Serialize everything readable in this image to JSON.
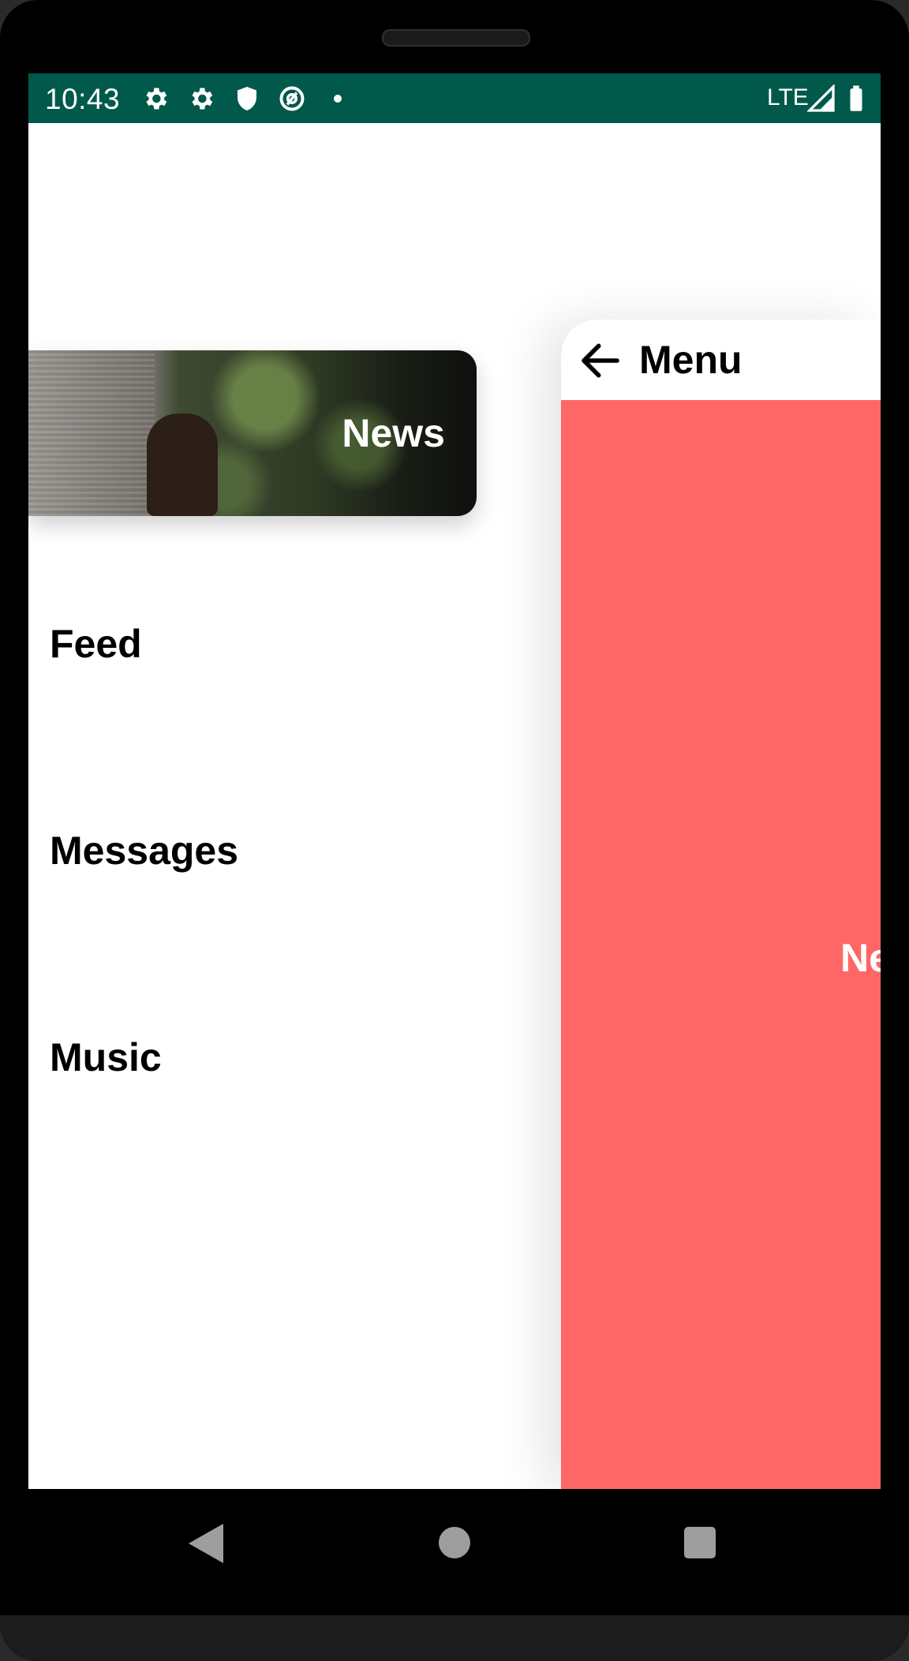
{
  "status_bar": {
    "time": "10:43",
    "network": "LTE",
    "icons": [
      "gear-icon",
      "gear-icon",
      "shield-icon",
      "at-sign-icon",
      "dot-icon",
      "signal-icon",
      "battery-icon"
    ],
    "background_color": "#00594a"
  },
  "drawer": {
    "selected_item": {
      "label": "News"
    },
    "items": [
      {
        "label": "Feed"
      },
      {
        "label": "Messages"
      },
      {
        "label": "Music"
      }
    ]
  },
  "main": {
    "header_title": "Menu",
    "back_icon": "back-arrow-icon",
    "content_label": "News",
    "background_color": "#ff6767"
  },
  "navigation_bar": {
    "icons": [
      "back-triangle-icon",
      "home-circle-icon",
      "recents-square-icon"
    ]
  }
}
